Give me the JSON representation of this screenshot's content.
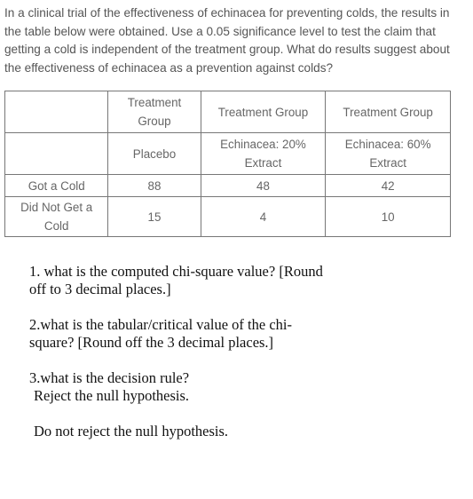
{
  "intro": "In a clinical trial of the effectiveness of echinacea for preventing colds, the results in the table below were obtained. Use a 0.05 significance level to test the claim that getting a cold is independent of the treatment group. What do results suggest about the effectiveness of echinacea as a prevention against colds?",
  "table": {
    "header_row": [
      "",
      "Treatment Group",
      "Treatment Group",
      "Treatment Group"
    ],
    "subheader_row": [
      "",
      "Placebo",
      "Echinacea: 20% Extract",
      "Echinacea: 60% Extract"
    ],
    "rows": [
      {
        "label": "Got a Cold",
        "values": [
          "88",
          "48",
          "42"
        ]
      },
      {
        "label": "Did Not Get a Cold",
        "values": [
          "15",
          "4",
          "10"
        ]
      }
    ]
  },
  "questions": {
    "q1_line1": "1.  what is the computed chi-square value? [Round",
    "q1_line2": "off to 3 decimal places.]",
    "q2_line1": "2.what is the tabular/critical value of the chi-",
    "q2_line2": "square? [Round off the 3 decimal places.]",
    "q3": "3.what is the decision rule?",
    "options": [
      "Reject the null hypothesis.",
      "Do not reject the null hypothesis."
    ]
  }
}
